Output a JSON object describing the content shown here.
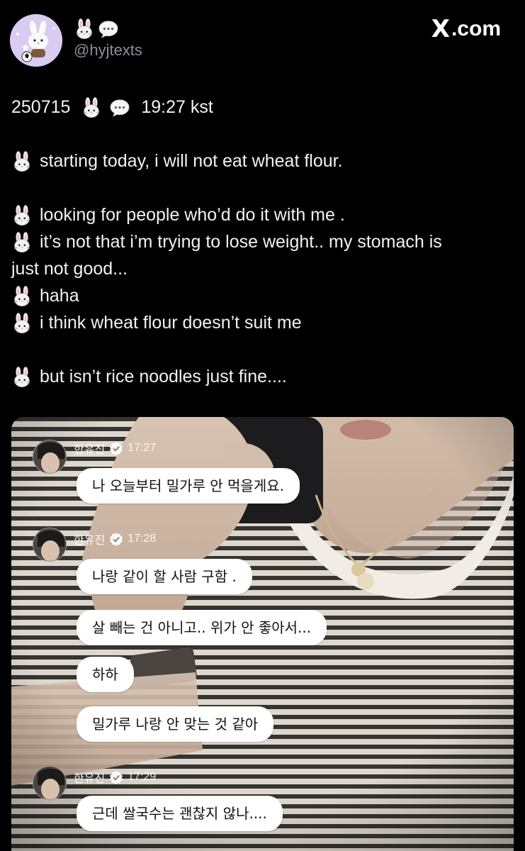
{
  "header": {
    "display_name_icons": [
      "bunny-icon",
      "speech-bubble-icon"
    ],
    "handle": "@hyjtexts",
    "brand": "X",
    "brand_suffix": ".com"
  },
  "tweet": {
    "date": "250715",
    "time": "19:27 kst",
    "lines": [
      "starting today, i will not eat wheat flour.",
      "looking for people who’d do it with me .",
      "it’s not that i’m trying to lose weight.. my stomach is",
      "just not good...",
      "haha",
      "i think wheat flour doesn’t suit me",
      "but isn’t rice noodles just fine...."
    ]
  },
  "chat": {
    "sender": "한유진",
    "groups": [
      {
        "time": "17:27",
        "messages": [
          "나 오늘부터 밀가루 안 먹을게요."
        ]
      },
      {
        "time": "17:28",
        "messages": [
          "나랑 같이 할 사람 구함 .",
          "살 빼는 건 아니고.. 위가 안 좋아서...",
          "하하",
          "밀가루 나랑 안 맞는 것 같아"
        ]
      },
      {
        "time": "17:29",
        "messages": [
          "근데 쌀국수는 괜찮지 않나...."
        ]
      }
    ]
  },
  "colors": {
    "background": "#000000",
    "text": "#f2f2f2",
    "handle": "#8b9096",
    "bubble": "#ffffff",
    "avatar_bg": "#d9ccf0"
  }
}
